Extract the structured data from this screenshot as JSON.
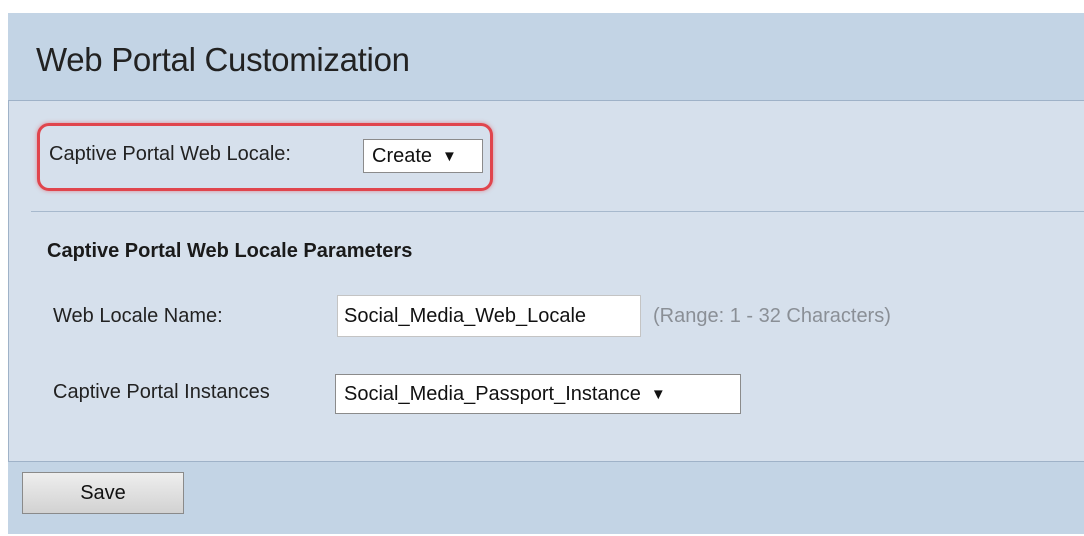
{
  "page": {
    "title": "Web Portal Customization"
  },
  "locale_selector": {
    "label": "Captive Portal Web Locale:",
    "selected": "Create",
    "arrow": "▼"
  },
  "parameters": {
    "heading": "Captive Portal Web Locale Parameters",
    "web_locale_name": {
      "label": "Web Locale Name:",
      "value": "Social_Media_Web_Locale",
      "hint": "(Range: 1 - 32 Characters)"
    },
    "instances": {
      "label": "Captive Portal Instances",
      "selected": "Social_Media_Passport_Instance",
      "arrow": "▼"
    }
  },
  "actions": {
    "save_label": "Save"
  },
  "colors": {
    "page_background": "#c3d4e5",
    "panel_background": "#d6e0ec",
    "highlight": "#e0454d",
    "hint_text": "#8a8f96"
  }
}
